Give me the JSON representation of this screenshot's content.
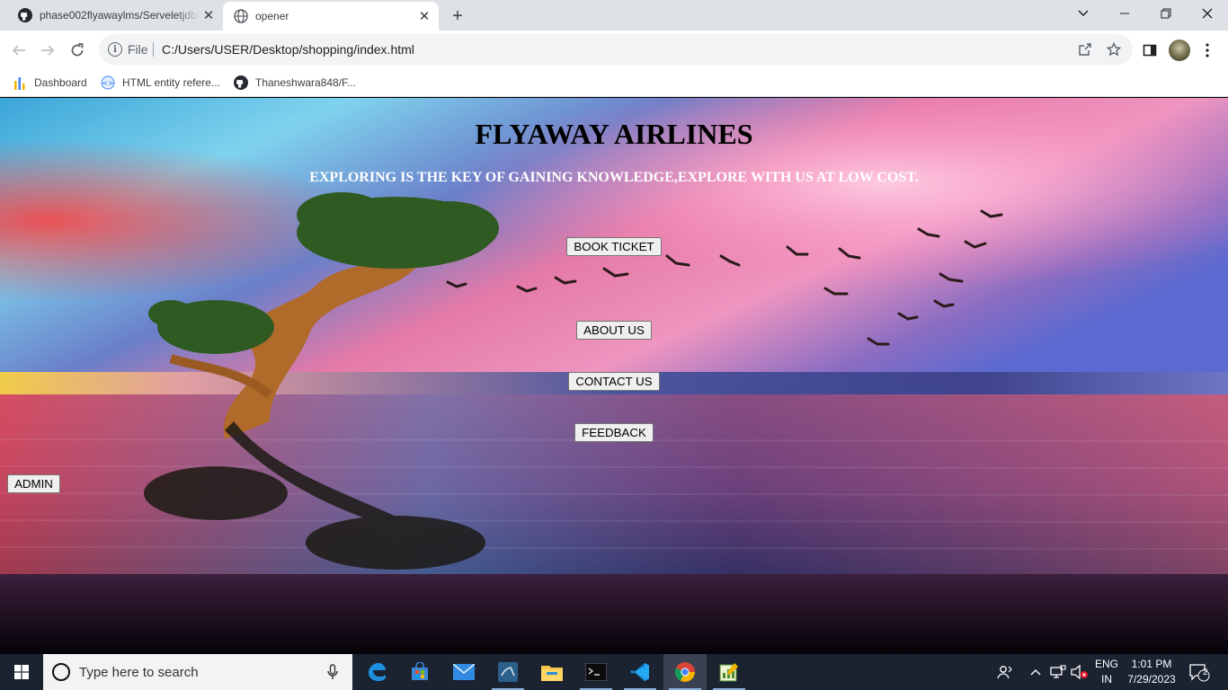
{
  "browser": {
    "tabs": [
      {
        "title": "phase002flyawaylms/Serveletjdbc",
        "icon": "github-icon"
      },
      {
        "title": "opener",
        "icon": "globe-icon"
      }
    ],
    "address": {
      "scheme": "File",
      "url": "C:/Users/USER/Desktop/shopping/index.html"
    },
    "bookmarks": [
      {
        "label": "Dashboard",
        "icon": "dashboard-icon"
      },
      {
        "label": "HTML entity refere...",
        "icon": "html-entity-icon"
      },
      {
        "label": "Thaneshwara848/F...",
        "icon": "github-icon"
      }
    ]
  },
  "page": {
    "title": "FLYAWAY AIRLINES",
    "subtitle": "EXPLORING IS THE KEY OF GAINING KNOWLEDGE,EXPLORE WITH US AT LOW COST.",
    "buttons": {
      "book": "BOOK TICKET",
      "about": "ABOUT US",
      "contact": "CONTACT US",
      "feedback": "FEEDBACK",
      "admin": "ADMIN"
    }
  },
  "taskbar": {
    "search_placeholder": "Type here to search",
    "language": {
      "line1": "ENG",
      "line2": "IN"
    },
    "time": "1:01 PM",
    "date": "7/29/2023",
    "notification_count": "2"
  },
  "colors": {
    "tabstrip": "#dee1e6",
    "taskbar": "#1b2230",
    "title_text": "#000000",
    "subtitle_text": "#ffffff"
  }
}
